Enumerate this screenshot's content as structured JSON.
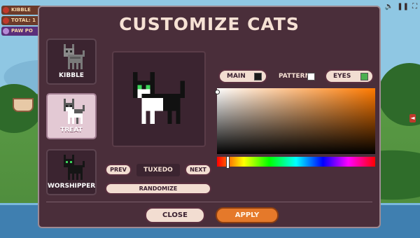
{
  "hud": {
    "kibble": "KIBBLE",
    "total": "TOTAL: 1",
    "paw": "PAW PO"
  },
  "modal": {
    "title": "CUSTOMIZE CATS",
    "presets": [
      {
        "label": "KIBBLE",
        "selected": false
      },
      {
        "label": "TREAT",
        "selected": true
      },
      {
        "label": "WORSHIPPER",
        "selected": false
      }
    ],
    "prev_label": "PREV",
    "pattern_name": "TUXEDO",
    "next_label": "NEXT",
    "randomize_label": "RANDOMIZE",
    "tabs": {
      "main": {
        "label": "MAIN",
        "color": "#1a1a1a"
      },
      "pattern": {
        "label": "PATTERN",
        "color": "#ffffff"
      },
      "eyes": {
        "label": "EYES",
        "color": "#4caf50"
      }
    },
    "picker": {
      "hue_color": "#ff7a00"
    },
    "close_label": "CLOSE",
    "apply_label": "APPLY"
  },
  "colors": {
    "modal_bg": "#4a2e3a",
    "accent": "#e5792a"
  }
}
